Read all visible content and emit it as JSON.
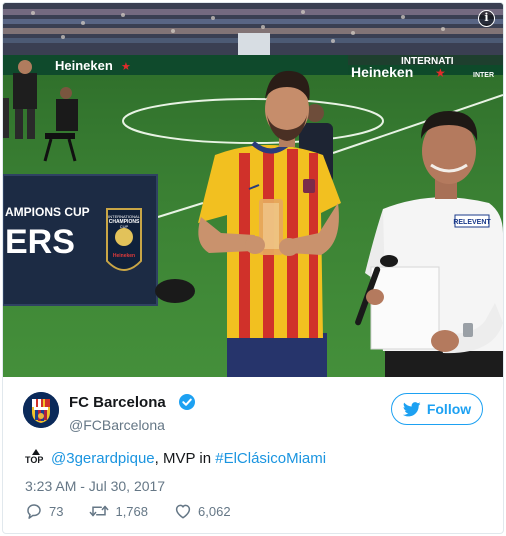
{
  "photo": {
    "banner_left": "Heineken",
    "banner_right": "Heineken",
    "banner_right_top": "INTERNATI",
    "banner_right_small": "INTER",
    "board_line1": "AMPIONS CUP",
    "board_line2": "ERS",
    "board_logo_line1": "INTERNATIONAL",
    "board_logo_line2": "CHAMPIONS",
    "board_logo_line3": "CUP",
    "board_logo_line4": "Heineken",
    "shirt_badge": "RELEVENT"
  },
  "tweet": {
    "author_name": "FC Barcelona",
    "author_handle": "@FCBarcelona",
    "follow_label": "Follow",
    "top_badge": "TOP",
    "mention": "@3gerardpique",
    "text_middle": ", MVP in ",
    "hashtag": "#ElClásicoMiami",
    "timestamp": "3:23 AM - Jul 30, 2017",
    "replies": "73",
    "retweets": "1,768",
    "likes": "6,062"
  },
  "colors": {
    "link": "#1b95e0",
    "follow": "#1da1f2",
    "muted": "#657786",
    "text": "#14171a"
  },
  "icons": [
    "info-icon",
    "verified-icon",
    "twitter-bird-icon",
    "top-emoji-icon",
    "reply-icon",
    "retweet-icon",
    "heart-icon"
  ]
}
